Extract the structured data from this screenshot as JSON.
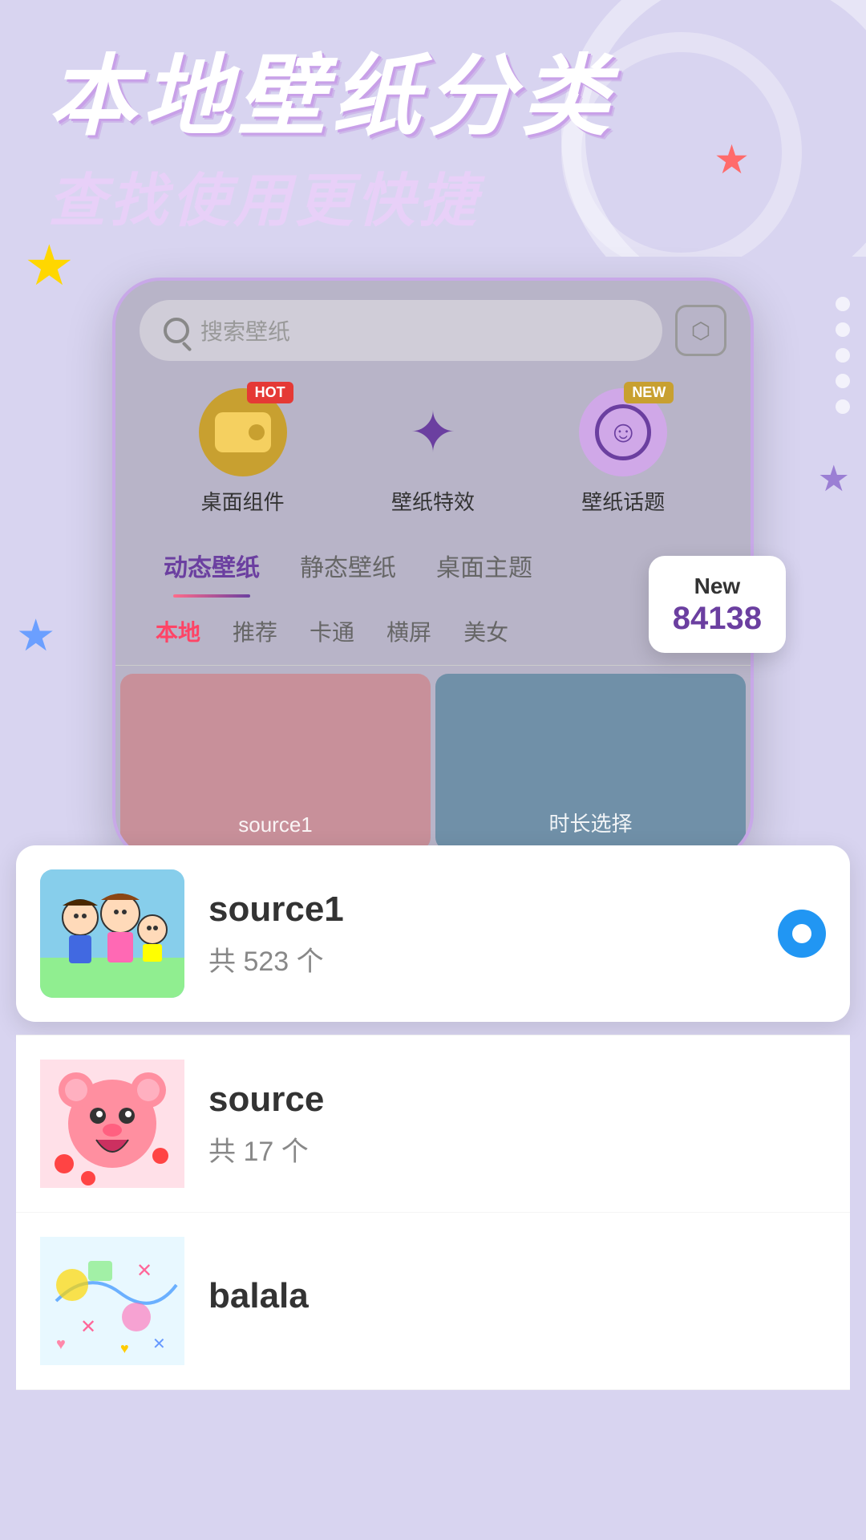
{
  "page": {
    "background_color": "#d8d4f0",
    "title_main": "本地壁纸分类",
    "title_sub": "查找使用更快捷"
  },
  "search": {
    "placeholder": "搜索壁纸"
  },
  "icons": [
    {
      "id": "desktop-widget",
      "label": "桌面组件",
      "badge": "HOT",
      "badge_type": "hot"
    },
    {
      "id": "wallpaper-effect",
      "label": "壁纸特效",
      "badge": "",
      "badge_type": ""
    },
    {
      "id": "wallpaper-topic",
      "label": "壁纸话题",
      "badge": "NEW",
      "badge_type": "new"
    }
  ],
  "main_tabs": [
    {
      "id": "dynamic",
      "label": "动态壁纸",
      "active": true
    },
    {
      "id": "static",
      "label": "静态壁纸",
      "active": false
    },
    {
      "id": "desktop-theme",
      "label": "桌面主题",
      "active": false
    }
  ],
  "sub_tabs": [
    {
      "id": "local",
      "label": "本地",
      "active": true
    },
    {
      "id": "recommend",
      "label": "推荐",
      "active": false
    },
    {
      "id": "cartoon",
      "label": "卡通",
      "active": false
    },
    {
      "id": "landscape",
      "label": "横屏",
      "active": false
    },
    {
      "id": "beauty",
      "label": "美女",
      "active": false
    }
  ],
  "wallpaper_cards": [
    {
      "id": "card1",
      "label": "source1",
      "color": "pink"
    },
    {
      "id": "card2",
      "label": "时长选择",
      "color": "blue"
    }
  ],
  "new_badge": {
    "label": "New",
    "number": "84138"
  },
  "list_items": [
    {
      "id": "source1",
      "title": "source1",
      "count": "共 523 个",
      "selected": true,
      "thumb_type": "cartoon"
    },
    {
      "id": "source",
      "title": "source",
      "count": "共 17 个",
      "selected": false,
      "thumb_type": "bear"
    },
    {
      "id": "balala",
      "title": "balala",
      "count": "",
      "selected": false,
      "thumb_type": "map"
    }
  ],
  "icons_unicode": {
    "search": "🔍",
    "export": "↗",
    "star": "✦",
    "radio_check": "●"
  }
}
